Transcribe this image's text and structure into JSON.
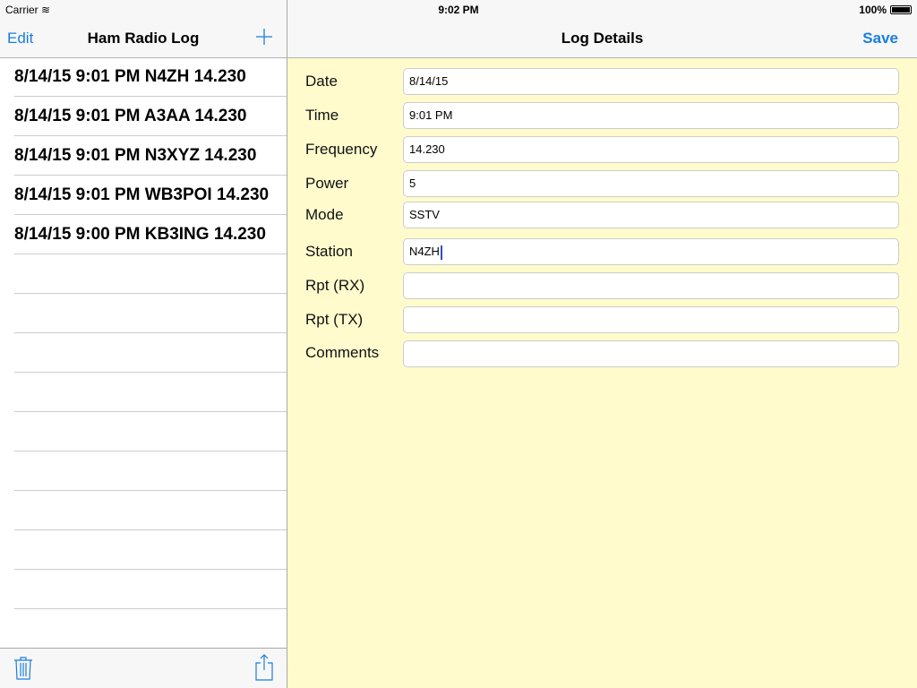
{
  "status": {
    "carrier": "Carrier",
    "time": "9:02 PM",
    "battery": "100%"
  },
  "master": {
    "title": "Ham Radio Log",
    "edit_label": "Edit",
    "add_icon": "plus-icon",
    "rows": [
      "8/14/15 9:01 PM N4ZH 14.230",
      "8/14/15 9:01 PM A3AA 14.230",
      "8/14/15 9:01 PM N3XYZ 14.230",
      "8/14/15 9:01 PM WB3POI 14.230",
      "8/14/15 9:00 PM KB3ING 14.230"
    ],
    "toolbar": {
      "left_icon": "trash-icon",
      "right_icon": "share-icon"
    }
  },
  "detail": {
    "title": "Log Details",
    "save_label": "Save",
    "fields": [
      {
        "label": "Date",
        "value": "8/14/15"
      },
      {
        "label": "Time",
        "value": "9:01 PM"
      },
      {
        "label": "Frequency",
        "value": "14.230"
      },
      {
        "label": "Power",
        "value": "5"
      },
      {
        "label": "Mode",
        "value": "SSTV"
      },
      {
        "label": "Station",
        "value": "N4ZH"
      },
      {
        "label": "Rpt (RX)",
        "value": ""
      },
      {
        "label": "Rpt (TX)",
        "value": ""
      },
      {
        "label": "Comments",
        "value": ""
      }
    ]
  },
  "colors": {
    "accent": "#1a7de0",
    "detail_bg": "#fffbcd"
  }
}
